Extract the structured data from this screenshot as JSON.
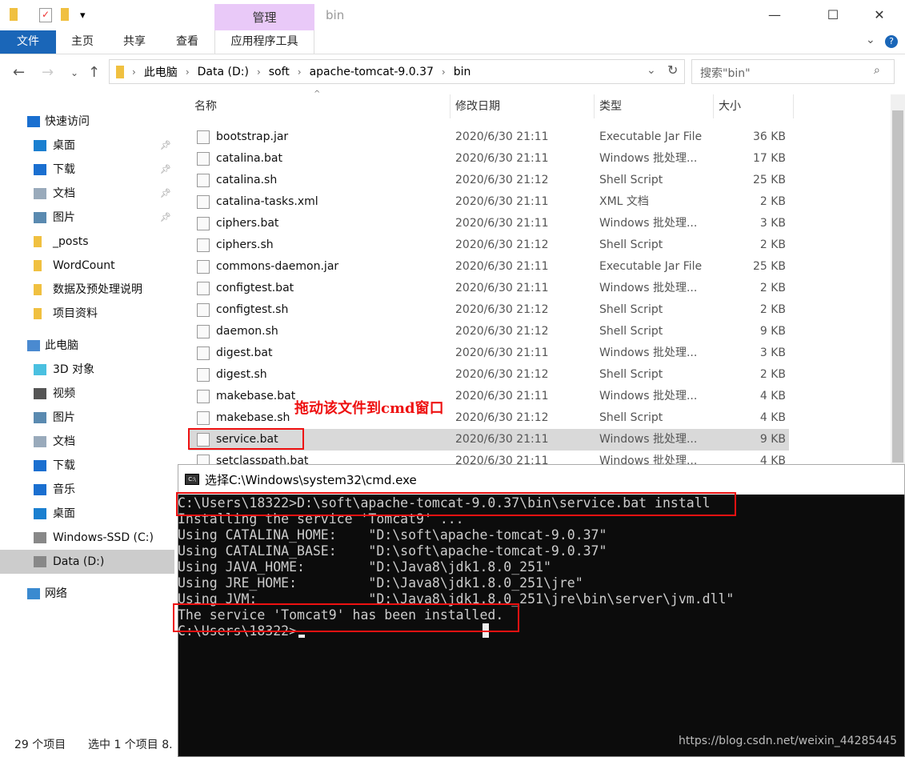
{
  "window": {
    "title": "bin",
    "context_tab": "管理",
    "minimize": "—",
    "maximize": "☐",
    "close": "✕",
    "help": "?",
    "expand": "⌄"
  },
  "ribbon": {
    "tabs": [
      "文件",
      "主页",
      "共享",
      "查看",
      "应用程序工具"
    ]
  },
  "address": {
    "crumbs": [
      "此电脑",
      "Data (D:)",
      "soft",
      "apache-tomcat-9.0.37",
      "bin"
    ],
    "search_placeholder": "搜索\"bin\""
  },
  "sidebar": {
    "items": [
      {
        "label": "快速访问",
        "icon": "star-icon",
        "top": true
      },
      {
        "label": "桌面",
        "icon": "desktop-icon",
        "pin": true
      },
      {
        "label": "下载",
        "icon": "download-icon",
        "pin": true
      },
      {
        "label": "文档",
        "icon": "document-icon",
        "pin": true
      },
      {
        "label": "图片",
        "icon": "picture-icon",
        "pin": true
      },
      {
        "label": "_posts",
        "icon": "folder-icon"
      },
      {
        "label": "WordCount",
        "icon": "folder-icon"
      },
      {
        "label": "数据及预处理说明",
        "icon": "folder-icon"
      },
      {
        "label": "项目资料",
        "icon": "folder-icon"
      },
      {
        "label": "此电脑",
        "icon": "computer-icon",
        "top": true
      },
      {
        "label": "3D 对象",
        "icon": "3d-objects-icon"
      },
      {
        "label": "视频",
        "icon": "video-icon"
      },
      {
        "label": "图片",
        "icon": "picture-icon"
      },
      {
        "label": "文档",
        "icon": "document-icon"
      },
      {
        "label": "下载",
        "icon": "download-icon"
      },
      {
        "label": "音乐",
        "icon": "music-icon"
      },
      {
        "label": "桌面",
        "icon": "desktop-icon"
      },
      {
        "label": "Windows-SSD (C:)",
        "icon": "drive-icon"
      },
      {
        "label": "Data (D:)",
        "icon": "drive-icon",
        "selected": true
      },
      {
        "label": "网络",
        "icon": "network-icon",
        "top": true
      }
    ]
  },
  "columns": [
    "名称",
    "修改日期",
    "类型",
    "大小"
  ],
  "files": [
    {
      "name": "bootstrap.jar",
      "date": "2020/6/30 21:11",
      "type": "Executable Jar File",
      "size": "36 KB"
    },
    {
      "name": "catalina.bat",
      "date": "2020/6/30 21:11",
      "type": "Windows 批处理...",
      "size": "17 KB"
    },
    {
      "name": "catalina.sh",
      "date": "2020/6/30 21:12",
      "type": "Shell Script",
      "size": "25 KB"
    },
    {
      "name": "catalina-tasks.xml",
      "date": "2020/6/30 21:11",
      "type": "XML 文档",
      "size": "2 KB"
    },
    {
      "name": "ciphers.bat",
      "date": "2020/6/30 21:11",
      "type": "Windows 批处理...",
      "size": "3 KB"
    },
    {
      "name": "ciphers.sh",
      "date": "2020/6/30 21:12",
      "type": "Shell Script",
      "size": "2 KB"
    },
    {
      "name": "commons-daemon.jar",
      "date": "2020/6/30 21:11",
      "type": "Executable Jar File",
      "size": "25 KB"
    },
    {
      "name": "configtest.bat",
      "date": "2020/6/30 21:11",
      "type": "Windows 批处理...",
      "size": "2 KB"
    },
    {
      "name": "configtest.sh",
      "date": "2020/6/30 21:12",
      "type": "Shell Script",
      "size": "2 KB"
    },
    {
      "name": "daemon.sh",
      "date": "2020/6/30 21:12",
      "type": "Shell Script",
      "size": "9 KB"
    },
    {
      "name": "digest.bat",
      "date": "2020/6/30 21:11",
      "type": "Windows 批处理...",
      "size": "3 KB"
    },
    {
      "name": "digest.sh",
      "date": "2020/6/30 21:12",
      "type": "Shell Script",
      "size": "2 KB"
    },
    {
      "name": "makebase.bat",
      "date": "2020/6/30 21:11",
      "type": "Windows 批处理...",
      "size": "4 KB"
    },
    {
      "name": "makebase.sh",
      "date": "2020/6/30 21:12",
      "type": "Shell Script",
      "size": "4 KB"
    },
    {
      "name": "service.bat",
      "date": "2020/6/30 21:11",
      "type": "Windows 批处理...",
      "size": "9 KB",
      "selected": true
    },
    {
      "name": "setclasspath.bat",
      "date": "2020/6/30 21:11",
      "type": "Windows 批处理...",
      "size": "4 KB"
    }
  ],
  "status": {
    "count": "29 个项目",
    "selected": "选中 1 个项目  8."
  },
  "annotation": "拖动该文件到cmd窗口",
  "cmd": {
    "title": "选择C:\\Windows\\system32\\cmd.exe",
    "lines": [
      "C:\\Users\\18322>D:\\soft\\apache-tomcat-9.0.37\\bin\\service.bat install",
      "Installing the service 'Tomcat9' ...",
      "Using CATALINA_HOME:    \"D:\\soft\\apache-tomcat-9.0.37\"",
      "Using CATALINA_BASE:    \"D:\\soft\\apache-tomcat-9.0.37\"",
      "Using JAVA_HOME:        \"D:\\Java8\\jdk1.8.0_251\"",
      "Using JRE_HOME:         \"D:\\Java8\\jdk1.8.0_251\\jre\"",
      "Using JVM:              \"D:\\Java8\\jdk1.8.0_251\\jre\\bin\\server\\jvm.dll\"",
      "The service 'Tomcat9' has been installed.",
      "C:\\Users\\18322>"
    ]
  },
  "watermark": "https://blog.csdn.net/weixin_44285445",
  "colors": {
    "file_tab": "#1a66b8",
    "context_tab": "#e9c9f8",
    "highlight": "#e11111",
    "console_bg": "#0c0c0c"
  }
}
